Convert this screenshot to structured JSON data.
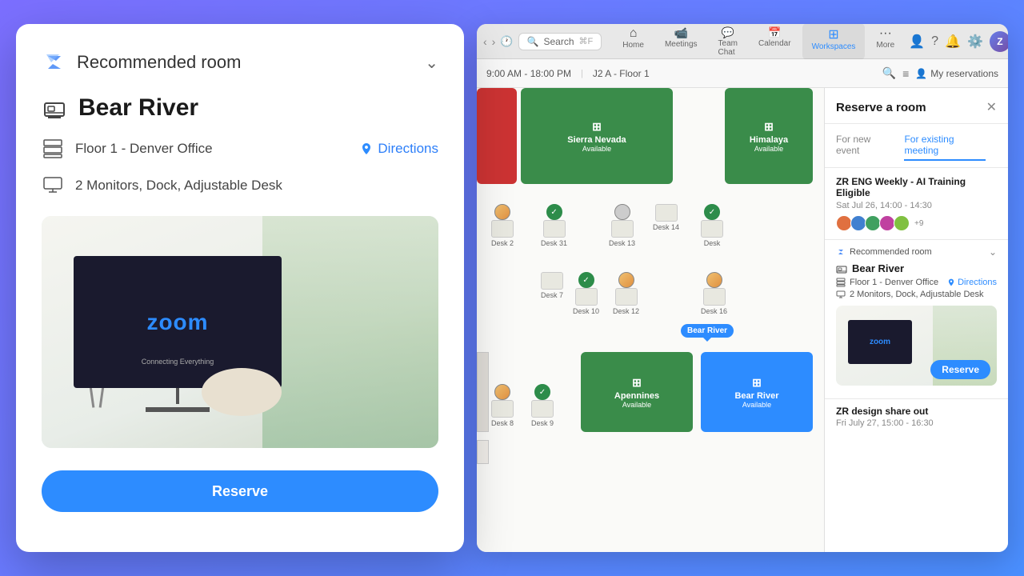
{
  "modal": {
    "header_label": "Recommended room",
    "room_name": "Bear River",
    "floor": "Floor 1 - Denver Office",
    "directions": "Directions",
    "amenities": "2 Monitors, Dock, Adjustable Desk",
    "reserve_btn": "Reserve"
  },
  "zoom_app": {
    "search_placeholder": "Search",
    "search_shortcut": "⌘F",
    "time_range": "9:00 AM - 18:00 PM",
    "location": "J2 A - Floor 1",
    "my_reservations": "My reservations",
    "nav_tabs": [
      {
        "label": "Home",
        "icon": "⌂"
      },
      {
        "label": "Meetings",
        "icon": "📹"
      },
      {
        "label": "Team Chat",
        "icon": "💬"
      },
      {
        "label": "Calendar",
        "icon": "📅"
      },
      {
        "label": "Workspaces",
        "icon": "⊞"
      },
      {
        "label": "More",
        "icon": "···"
      }
    ]
  },
  "panel": {
    "title": "Reserve a room",
    "tab_new": "For new event",
    "tab_existing": "For existing meeting",
    "meeting_title": "ZR ENG Weekly - AI Training Eligible",
    "meeting_time": "Sat Jul 26, 14:00 - 14:30",
    "attendee_count": "+9",
    "rec_label": "Recommended room",
    "room_name": "Bear River",
    "floor": "Floor 1 - Denver Office",
    "directions": "Directions",
    "amenities": "2 Monitors, Dock, Adjustable Desk",
    "reserve_btn": "Reserve",
    "next_meeting_title": "ZR design share out",
    "next_meeting_time": "Fri July 27, 15:00 - 16:30"
  },
  "map": {
    "rooms": [
      {
        "name": "Sierra Nevada",
        "status": "Available",
        "type": "available"
      },
      {
        "name": "Himalaya",
        "status": "Available",
        "type": "available"
      },
      {
        "name": "Apennines",
        "status": "Available",
        "type": "available"
      },
      {
        "name": "Bear River",
        "status": "Available",
        "type": "selected"
      }
    ],
    "tooltip": "Bear River"
  }
}
